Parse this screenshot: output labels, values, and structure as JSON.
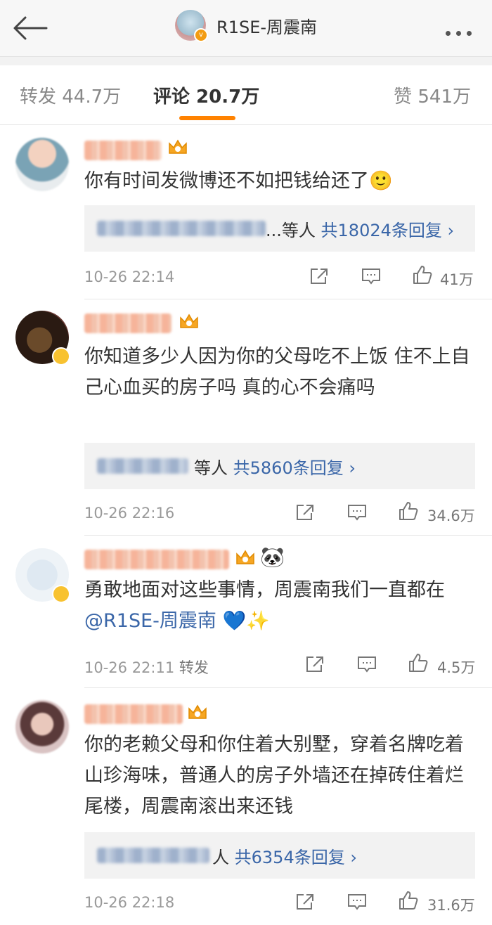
{
  "header": {
    "title": "R1SE-周震南"
  },
  "tabs": [
    {
      "label": "转发 44.7万"
    },
    {
      "label": "评论 20.7万"
    },
    {
      "label": "赞 541万"
    }
  ],
  "comments": [
    {
      "text": "你有时间发微博还不如把钱给还了🙂",
      "reply_suffix": "...等人",
      "reply_link": "共18024条回复 ›",
      "time": "10-26 22:14",
      "extra": "",
      "likes": "41万"
    },
    {
      "text": "你知道多少人因为你的父母吃不上饭 住不上自己心血买的房子吗 真的心不会痛吗",
      "reply_suffix": "等人",
      "reply_link": "共5860条回复 ›",
      "time": "10-26 22:16",
      "extra": "",
      "likes": "34.6万"
    },
    {
      "text_prefix": "勇敢地面对这些事情，周震南我们一直都在",
      "mention": "@R1SE-周震南",
      "text_suffix": " 💙✨",
      "time": "10-26 22:11",
      "extra": "转发",
      "likes": "4.5万"
    },
    {
      "text": "你的老赖父母和你住着大别墅，穿着名牌吃着山珍海味，普通人的房子外墙还在掉砖住着烂尾楼，周震南滚出来还钱",
      "reply_suffix": "人",
      "reply_link": "共6354条回复 ›",
      "time": "10-26 22:18",
      "extra": "",
      "likes": "31.6万"
    }
  ],
  "icons": {
    "back": "arrow-left-icon",
    "more": "more-dots-icon",
    "share": "share-icon",
    "reply": "comment-icon",
    "like": "thumbs-up-icon",
    "crown": "crown-vip-icon",
    "panda": "panda-emoji"
  },
  "colors": {
    "accent": "#ff8200",
    "link": "#3a66a8",
    "crown": "#f6a623"
  }
}
